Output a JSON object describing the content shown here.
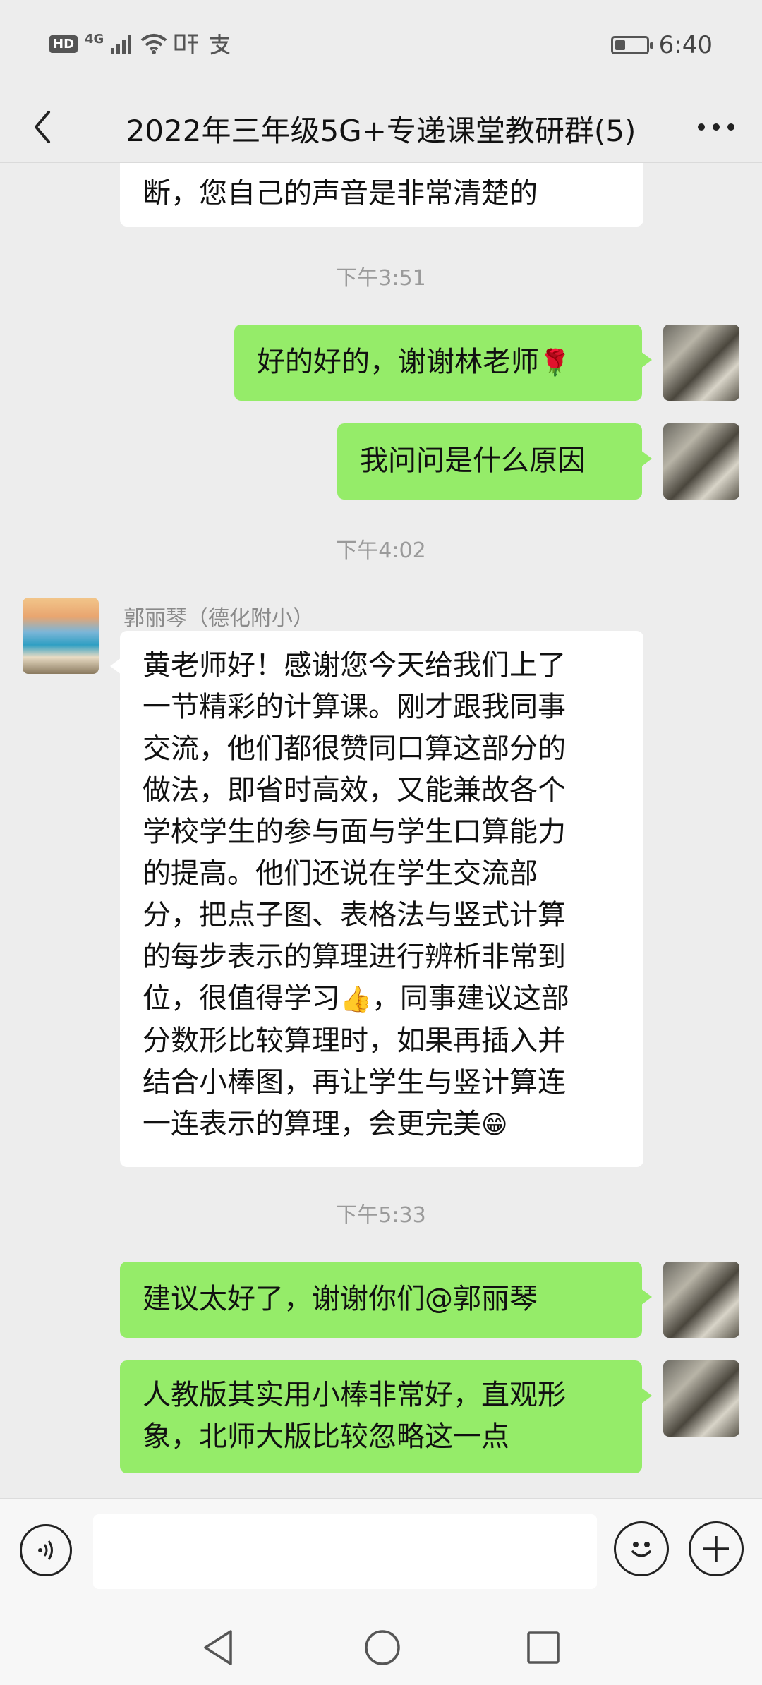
{
  "status": {
    "network": "4G",
    "hd": "HD",
    "time": "6:40"
  },
  "header": {
    "title": "2022年三年级5G+专递课堂教研群(5)"
  },
  "messages": {
    "m0": {
      "line1": "断，您自己的声音是非常清楚的"
    },
    "t1": "下午3:51",
    "m1": {
      "text": "好的好的，谢谢林老师",
      "emoji": "🌹"
    },
    "m2": {
      "text": "我问问是什么原因"
    },
    "t2": "下午4:02",
    "m3": {
      "sender": "郭丽琴（德化附小）",
      "lines": [
        "黄老师好！感谢您今天给我们上了",
        "一节精彩的计算课。刚才跟我同事",
        "交流，他们都很赞同口算这部分的",
        "做法，即省时高效，又能兼故各个",
        "学校学生的参与面与学生口算能力",
        "的提高。他们还说在学生交流部",
        "分，把点子图、表格法与竖式计算",
        "的每步表示的算理进行辨析非常到",
        "位，很值得学习",
        "，同事建议这部",
        "分数形比较算理时，如果再插入并",
        "结合小棒图，再让学生与竖计算连",
        "一连表示的算理，会更完美"
      ],
      "emoji_thumb": "👍",
      "emoji_grin": "😁"
    },
    "t3": "下午5:33",
    "m4": {
      "text": "建议太好了，谢谢你们@郭丽琴"
    },
    "m5": {
      "line1": "人教版其实用小棒非常好，直观形",
      "line2": "象，北师大版比较忽略这一点"
    }
  },
  "input": {
    "placeholder": ""
  },
  "icons": {
    "back": "back-arrow-icon",
    "more": "more-dots-icon",
    "voice": "voice-icon",
    "emoji": "emoji-icon",
    "plus": "plus-icon"
  }
}
